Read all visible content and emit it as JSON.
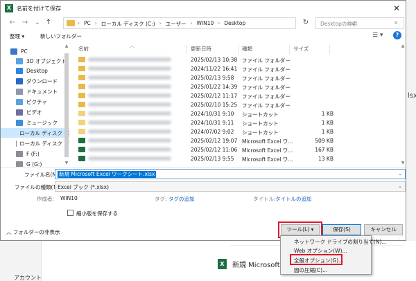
{
  "background_app": {
    "file_ext_fragment": "lsx",
    "new_item_label": "新規 Microsoft",
    "new_item_icon": "excel-icon",
    "account_label": "アカウント"
  },
  "dialog": {
    "title": "名前を付けて保存",
    "close_glyph": "✕",
    "nav": {
      "back": "←",
      "forward": "→",
      "recent": "⌄",
      "up": "↑"
    },
    "breadcrumb": [
      "PC",
      "ローカル ディスク (C:)",
      "ユーザー",
      "WIN10",
      "Desktop"
    ],
    "breadcrumb_sep": "›",
    "address_caret": "⌄",
    "refresh_glyph": "↻",
    "search_placeholder": "Desktopの検索",
    "search_icon": "⌕",
    "toolbar": {
      "organize": "整理 ▾",
      "new_folder": "新しいフォルダー",
      "view_glyph": "☰ ▾",
      "help": "?"
    },
    "nav_pane": [
      {
        "label": "PC",
        "icon": "pc-icon",
        "color": "#3a78c4"
      },
      {
        "label": "3D オブジェクト",
        "icon": "3d-objects-icon",
        "color": "#59a3e0"
      },
      {
        "label": "Desktop",
        "icon": "desktop-icon",
        "color": "#2e86de"
      },
      {
        "label": "ダウンロード",
        "icon": "download-icon",
        "color": "#2a6ac2"
      },
      {
        "label": "ドキュメント",
        "icon": "documents-icon",
        "color": "#8e99a8"
      },
      {
        "label": "ピクチャ",
        "icon": "pictures-icon",
        "color": "#5aa3d8"
      },
      {
        "label": "ビデオ",
        "icon": "videos-icon",
        "color": "#6e6e9e"
      },
      {
        "label": "ミュージック",
        "icon": "music-icon",
        "color": "#3d8fd6"
      },
      {
        "label": "ローカル ディスク (C",
        "icon": "drive-icon",
        "color": "#8a8f96",
        "selected": true
      },
      {
        "label": "ローカル ディスク (E",
        "icon": "drive-icon",
        "color": "#8a8f96"
      },
      {
        "label": "F (F:)",
        "icon": "drive-icon",
        "color": "#8a8f96"
      },
      {
        "label": "G (G:)",
        "icon": "drive-icon",
        "color": "#8a8f96"
      }
    ],
    "columns": {
      "name": "名前",
      "modified": "更新日時",
      "type": "種類",
      "size": "サイズ"
    },
    "files": [
      {
        "date": "2025/02/13 10:38",
        "type": "ファイル フォルダー",
        "size": "",
        "icon": "folder-icon"
      },
      {
        "date": "2024/11/22 16:41",
        "type": "ファイル フォルダー",
        "size": "",
        "icon": "folder-icon"
      },
      {
        "date": "2025/02/13 9:58",
        "type": "ファイル フォルダー",
        "size": "",
        "icon": "folder-icon"
      },
      {
        "date": "2025/01/22 14:39",
        "type": "ファイル フォルダー",
        "size": "",
        "icon": "folder-icon"
      },
      {
        "date": "2025/02/12 11:17",
        "type": "ファイル フォルダー",
        "size": "",
        "icon": "folder-icon"
      },
      {
        "date": "2025/02/10 15:25",
        "type": "ファイル フォルダー",
        "size": "",
        "icon": "folder-icon"
      },
      {
        "date": "2024/10/31 9:10",
        "type": "ショートカット",
        "size": "1 KB",
        "icon": "shortcut-icon"
      },
      {
        "date": "2024/10/31 9:11",
        "type": "ショートカット",
        "size": "1 KB",
        "icon": "shortcut-icon"
      },
      {
        "date": "2024/07/02 9:02",
        "type": "ショートカット",
        "size": "1 KB",
        "icon": "shortcut-icon"
      },
      {
        "date": "2025/02/12 19:07",
        "type": "Microsoft Excel ワ...",
        "size": "509 KB",
        "icon": "excel-icon"
      },
      {
        "date": "2025/02/12 11:06",
        "type": "Microsoft Excel ワ...",
        "size": "167 KB",
        "icon": "excel-icon"
      },
      {
        "date": "2025/02/13 9:55",
        "type": "Microsoft Excel ワ...",
        "size": "13 KB",
        "icon": "excel-icon"
      }
    ],
    "filename_label": "ファイル名(N):",
    "filename_value": "新規 Microsoft Excel ワークシート.xlsx",
    "filetype_label": "ファイルの種類(T):",
    "filetype_value": "Excel ブック (*.xlsx)",
    "author_label": "作成者:",
    "author_value": "WIN10",
    "tags_label": "タグ:",
    "tags_value": "タグの追加",
    "title_label": "タイトル:",
    "title_value": "タイトルの追加",
    "thumbnail_label": "縮小版を保存する",
    "hide_folders": "フォルダーの非表示",
    "buttons": {
      "tools": "ツール(L)  ▾",
      "save": "保存(S)",
      "cancel": "キャンセル"
    },
    "tools_menu": [
      "ネットワーク ドライブの割り当て(N)...",
      "Web オプション(W)...",
      "全般オプション(G)...",
      "図の圧縮(C)..."
    ],
    "highlight_color": "#e0192b"
  }
}
